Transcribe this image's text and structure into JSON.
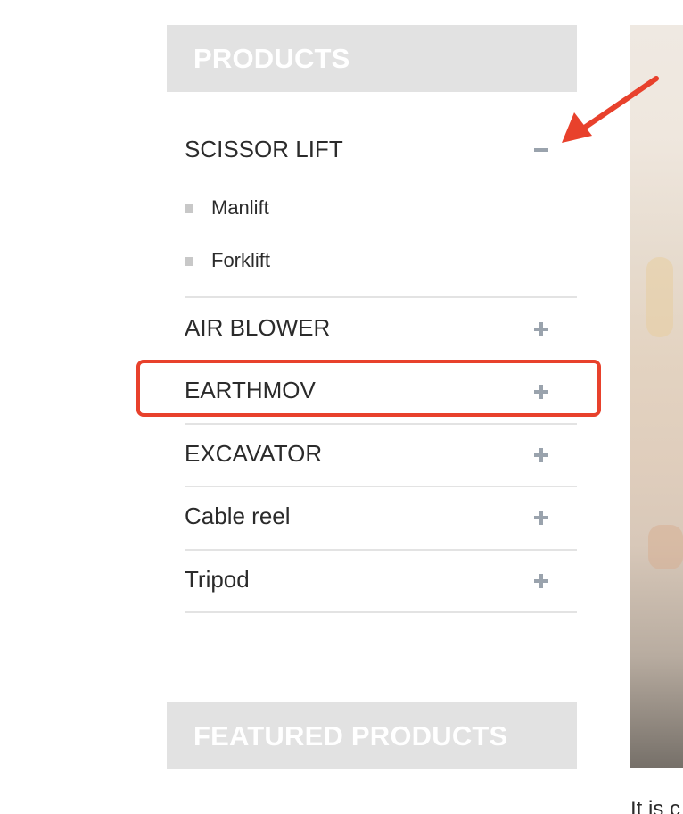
{
  "sidebar": {
    "products_title": "PRODUCTS",
    "featured_title": "FEATURED PRODUCTS",
    "categories": [
      {
        "label": "SCISSOR LIFT",
        "state": "expanded",
        "toggle_icon": "minus-icon",
        "subitems": [
          {
            "label": "Manlift"
          },
          {
            "label": "Forklift"
          }
        ]
      },
      {
        "label": "AIR BLOWER",
        "state": "collapsed",
        "toggle_icon": "plus-icon"
      },
      {
        "label": "EARTHMOV",
        "state": "collapsed",
        "toggle_icon": "plus-icon"
      },
      {
        "label": "EXCAVATOR",
        "state": "collapsed",
        "toggle_icon": "plus-icon"
      },
      {
        "label": "Cable reel",
        "state": "collapsed",
        "toggle_icon": "plus-icon"
      },
      {
        "label": "Tripod",
        "state": "collapsed",
        "toggle_icon": "plus-icon"
      }
    ]
  },
  "main": {
    "body_text": "It is c"
  },
  "colors": {
    "header_bg": "#e2e2e2",
    "header_text": "#ffffff",
    "icon_gray": "#9aa3ad",
    "annotation_red": "#e8412c",
    "divider": "#e3e3e3"
  }
}
